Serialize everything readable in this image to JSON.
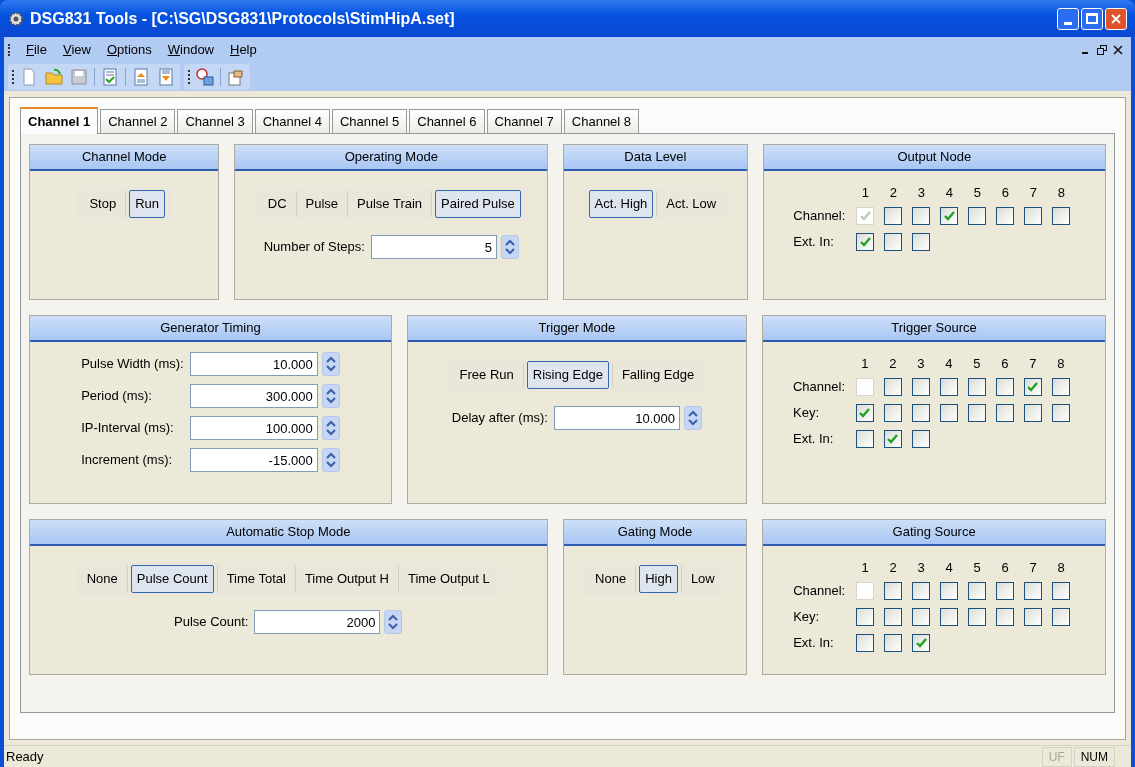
{
  "window": {
    "title": "DSG831 Tools - [C:\\SG\\DSG831\\Protocols\\StimHipA.set]"
  },
  "menu": [
    {
      "label": "File"
    },
    {
      "label": "View"
    },
    {
      "label": "Options"
    },
    {
      "label": "Window"
    },
    {
      "label": "Help"
    }
  ],
  "tabs": [
    {
      "label": "Channel 1",
      "selected": true
    },
    {
      "label": "Channel 2",
      "selected": false
    },
    {
      "label": "Channel 3",
      "selected": false
    },
    {
      "label": "Channel 4",
      "selected": false
    },
    {
      "label": "Channel 5",
      "selected": false
    },
    {
      "label": "Channel 6",
      "selected": false
    },
    {
      "label": "Channel 7",
      "selected": false
    },
    {
      "label": "Channel 8",
      "selected": false
    }
  ],
  "rows": [
    [
      {
        "title": "Channel Mode",
        "kind": "segmented",
        "options": [
          {
            "label": "Stop",
            "selected": false
          },
          {
            "label": "Run",
            "selected": true
          }
        ]
      },
      {
        "title": "Operating Mode",
        "kind": "segmented",
        "options": [
          {
            "label": "DC",
            "selected": false
          },
          {
            "label": "Pulse",
            "selected": false
          },
          {
            "label": "Pulse Train",
            "selected": false
          },
          {
            "label": "Paired Pulse",
            "selected": true
          }
        ],
        "fields": [
          {
            "label": "Number of Steps:",
            "value": "5"
          }
        ]
      },
      {
        "title": "Data Level",
        "kind": "segmented",
        "options": [
          {
            "label": "Act. High",
            "selected": true
          },
          {
            "label": "Act. Low",
            "selected": false
          }
        ]
      },
      {
        "title": "Output Node",
        "kind": "checkgrid",
        "columns": [
          "1",
          "2",
          "3",
          "4",
          "5",
          "6",
          "7",
          "8"
        ],
        "grid": [
          {
            "label": "Channel:",
            "boxes": [
              {
                "checked": true,
                "disabled": true
              },
              {
                "checked": false,
                "disabled": false
              },
              {
                "checked": false,
                "disabled": false
              },
              {
                "checked": true,
                "disabled": false
              },
              {
                "checked": false,
                "disabled": false
              },
              {
                "checked": false,
                "disabled": false
              },
              {
                "checked": false,
                "disabled": false
              },
              {
                "checked": false,
                "disabled": false
              }
            ]
          },
          {
            "label": "Ext. In:",
            "boxes": [
              {
                "checked": true,
                "disabled": false
              },
              {
                "checked": false,
                "disabled": false
              },
              {
                "checked": false,
                "disabled": false
              }
            ]
          }
        ]
      }
    ],
    [
      {
        "title": "Generator Timing",
        "kind": "timing",
        "fields": [
          {
            "label": "Pulse Width (ms):",
            "value": "10.000"
          },
          {
            "label": "Period (ms):",
            "value": "300.000"
          },
          {
            "label": "IP-Interval (ms):",
            "value": "100.000"
          },
          {
            "label": "Increment (ms):",
            "value": "-15.000"
          }
        ]
      },
      {
        "title": "Trigger Mode",
        "kind": "segmented",
        "options": [
          {
            "label": "Free Run",
            "selected": false
          },
          {
            "label": "Rising Edge",
            "selected": true
          },
          {
            "label": "Falling Edge",
            "selected": false
          }
        ],
        "fields": [
          {
            "label": "Delay after (ms):",
            "value": "10.000"
          }
        ]
      },
      {
        "title": "Trigger Source",
        "kind": "checkgrid",
        "columns": [
          "1",
          "2",
          "3",
          "4",
          "5",
          "6",
          "7",
          "8"
        ],
        "grid": [
          {
            "label": "Channel:",
            "boxes": [
              {
                "checked": false,
                "disabled": true
              },
              {
                "checked": false,
                "disabled": false
              },
              {
                "checked": false,
                "disabled": false
              },
              {
                "checked": false,
                "disabled": false
              },
              {
                "checked": false,
                "disabled": false
              },
              {
                "checked": false,
                "disabled": false
              },
              {
                "checked": true,
                "disabled": false
              },
              {
                "checked": false,
                "disabled": false
              }
            ]
          },
          {
            "label": "Key:",
            "boxes": [
              {
                "checked": true,
                "disabled": false
              },
              {
                "checked": false,
                "disabled": false
              },
              {
                "checked": false,
                "disabled": false
              },
              {
                "checked": false,
                "disabled": false
              },
              {
                "checked": false,
                "disabled": false
              },
              {
                "checked": false,
                "disabled": false
              },
              {
                "checked": false,
                "disabled": false
              },
              {
                "checked": false,
                "disabled": false
              }
            ]
          },
          {
            "label": "Ext. In:",
            "boxes": [
              {
                "checked": false,
                "disabled": false
              },
              {
                "checked": true,
                "disabled": false
              },
              {
                "checked": false,
                "disabled": false
              }
            ]
          }
        ]
      }
    ],
    [
      {
        "title": "Automatic Stop Mode",
        "kind": "segmented",
        "options": [
          {
            "label": "None",
            "selected": false
          },
          {
            "label": "Pulse Count",
            "selected": true
          },
          {
            "label": "Time Total",
            "selected": false
          },
          {
            "label": "Time Output H",
            "selected": false
          },
          {
            "label": "Time Output L",
            "selected": false
          }
        ],
        "fields": [
          {
            "label": "Pulse Count:",
            "value": "2000"
          }
        ]
      },
      {
        "title": "Gating Mode",
        "kind": "segmented",
        "options": [
          {
            "label": "None",
            "selected": false
          },
          {
            "label": "High",
            "selected": true
          },
          {
            "label": "Low",
            "selected": false
          }
        ]
      },
      {
        "title": "Gating Source",
        "kind": "checkgrid",
        "columns": [
          "1",
          "2",
          "3",
          "4",
          "5",
          "6",
          "7",
          "8"
        ],
        "grid": [
          {
            "label": "Channel:",
            "boxes": [
              {
                "checked": false,
                "disabled": true
              },
              {
                "checked": false,
                "disabled": false
              },
              {
                "checked": false,
                "disabled": false
              },
              {
                "checked": false,
                "disabled": false
              },
              {
                "checked": false,
                "disabled": false
              },
              {
                "checked": false,
                "disabled": false
              },
              {
                "checked": false,
                "disabled": false
              },
              {
                "checked": false,
                "disabled": false
              }
            ]
          },
          {
            "label": "Key:",
            "boxes": [
              {
                "checked": false,
                "disabled": false
              },
              {
                "checked": false,
                "disabled": false
              },
              {
                "checked": false,
                "disabled": false
              },
              {
                "checked": false,
                "disabled": false
              },
              {
                "checked": false,
                "disabled": false
              },
              {
                "checked": false,
                "disabled": false
              },
              {
                "checked": false,
                "disabled": false
              },
              {
                "checked": false,
                "disabled": false
              }
            ]
          },
          {
            "label": "Ext. In:",
            "boxes": [
              {
                "checked": false,
                "disabled": false
              },
              {
                "checked": false,
                "disabled": false
              },
              {
                "checked": true,
                "disabled": false
              }
            ]
          }
        ]
      }
    ]
  ],
  "status_bar": {
    "text": "Ready",
    "indicators": [
      {
        "label": "UF",
        "on": false
      },
      {
        "label": "NUM",
        "on": true
      }
    ]
  }
}
